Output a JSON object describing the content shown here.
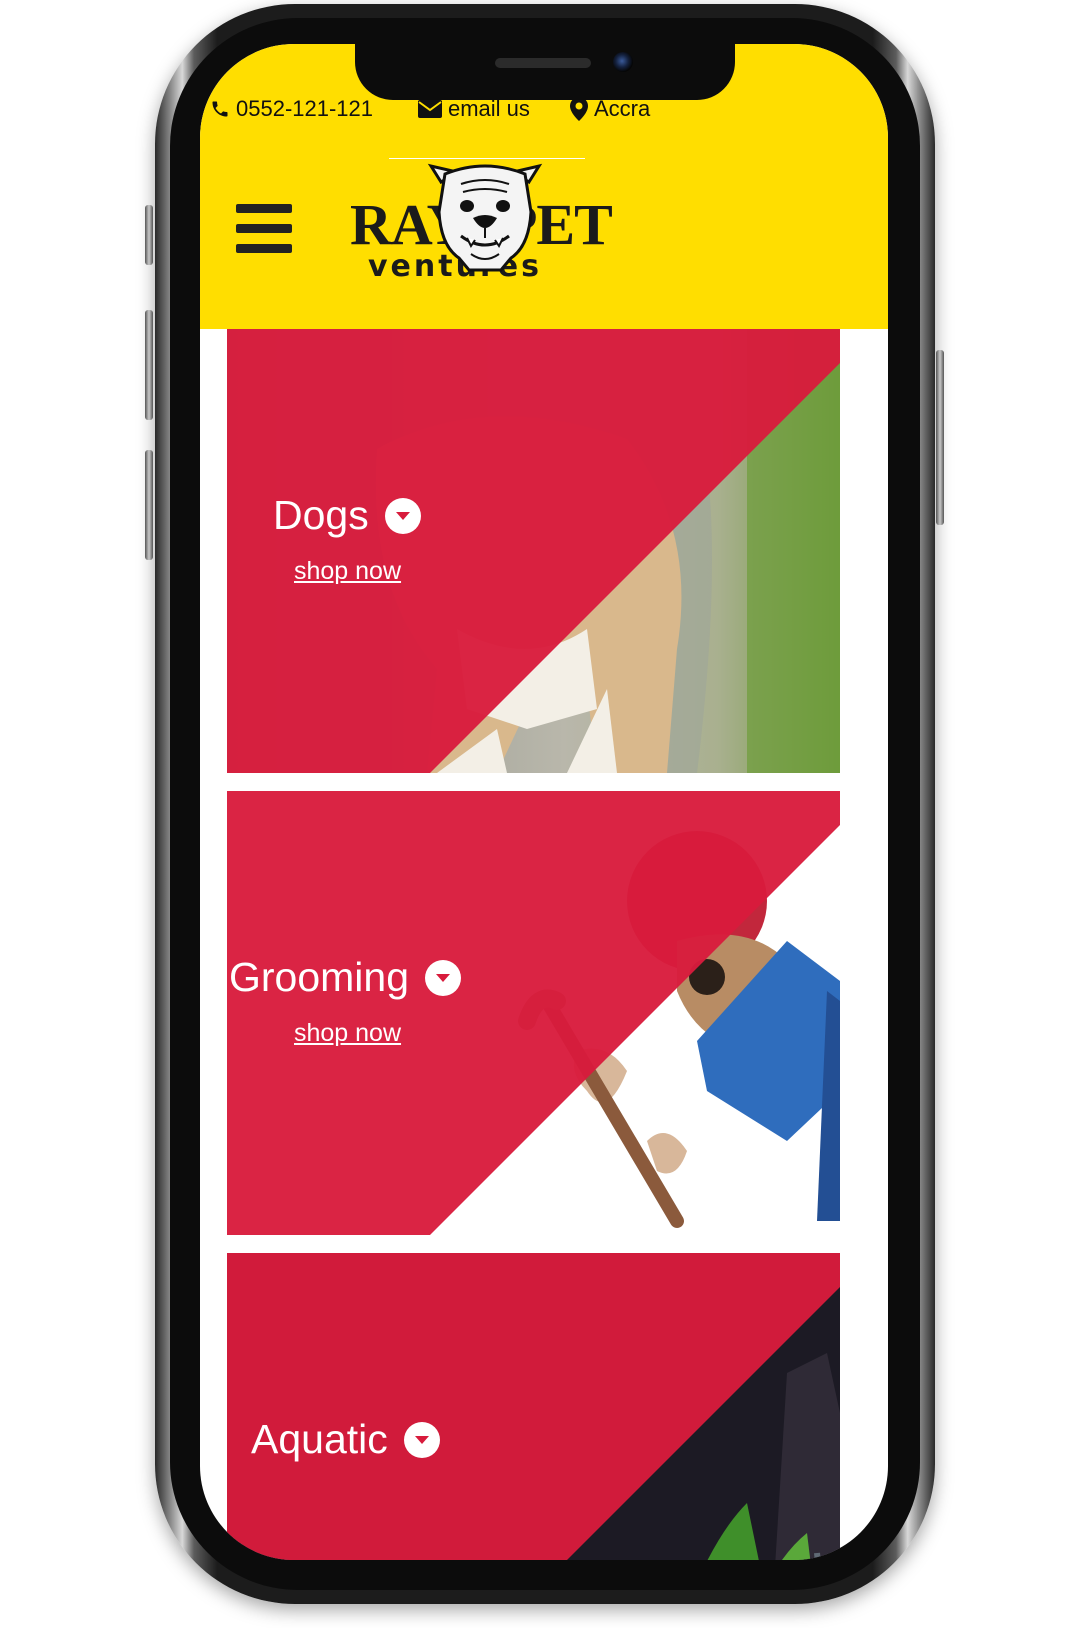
{
  "topbar": {
    "phone": "0552-121-121",
    "email": "email us",
    "location": "Accra",
    "icons": [
      "phone-icon",
      "envelope-icon",
      "map-marker-icon"
    ]
  },
  "logo": {
    "word_left": "RAY",
    "word_right": "PET",
    "subtitle": "ventures"
  },
  "categories": [
    {
      "title": "Dogs",
      "link": "shop now"
    },
    {
      "title": "Grooming",
      "link": "shop now"
    },
    {
      "title": "Aquatic"
    }
  ],
  "colors": {
    "header": "#ffde00",
    "accent": "#d81b3c",
    "text": "#111111"
  }
}
